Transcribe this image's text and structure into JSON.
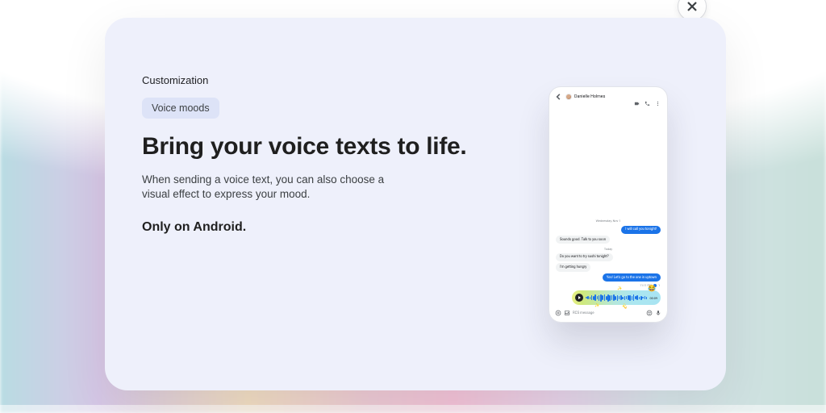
{
  "close_label": "Close",
  "eyebrow": "Customization",
  "chip": "Voice moods",
  "headline": "Bring your voice texts to life.",
  "body": "When sending a voice text, you can also choose a visual effect to express your mood.",
  "only": "Only on Android.",
  "phone": {
    "contact_name": "Danielle Holmes",
    "date1": "Wednesday, Nov 1",
    "m1": "I will call you tonight!",
    "m2": "Sounds good. Talk to you soon",
    "date2": "Today",
    "m3": "Do you want to try sushi tonight?",
    "m4": "I'm getting hungry",
    "m5": "Yes! Let's go to the one in uptown",
    "timestamp": "11:11 PM",
    "duration": "00:09",
    "compose_placeholder": "RCS message"
  }
}
